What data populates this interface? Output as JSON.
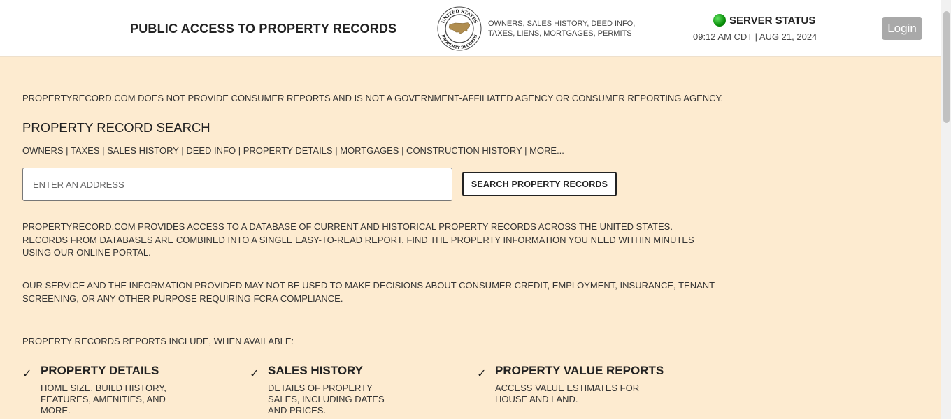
{
  "header": {
    "title": "PUBLIC ACCESS TO PROPERTY RECORDS",
    "seal_text_top": "UNITED STATES",
    "seal_text_bottom": "PROPERTY RECORDS",
    "tagline_line1": "OWNERS, SALES HISTORY, DEED INFO,",
    "tagline_line2": "TAXES, LIENS, MORTGAGES, PERMITS",
    "server_status_label": "SERVER STATUS",
    "server_status_color": "#1aa31a",
    "datetime": "09:12 AM CDT | AUG 21, 2024",
    "login_label": "Login"
  },
  "main": {
    "disclaimer": "PROPERTYRECORD.COM DOES NOT PROVIDE CONSUMER REPORTS AND IS NOT A GOVERNMENT-AFFILIATED AGENCY OR CONSUMER REPORTING AGENCY.",
    "search_heading": "PROPERTY RECORD SEARCH",
    "search_links": "OWNERS | TAXES | SALES HISTORY | DEED INFO | PROPERTY DETAILS | MORTGAGES | CONSTRUCTION HISTORY | MORE...",
    "address_placeholder": "ENTER AN ADDRESS",
    "address_value": "",
    "search_button_label": "SEARCH PROPERTY RECORDS",
    "paragraph1": "PROPERTYRECORD.COM PROVIDES ACCESS TO A DATABASE OF CURRENT AND HISTORICAL PROPERTY RECORDS ACROSS THE UNITED STATES. RECORDS FROM DATABASES ARE COMBINED INTO A SINGLE EASY-TO-READ REPORT. FIND THE PROPERTY INFORMATION YOU NEED WITHIN MINUTES USING OUR ONLINE PORTAL.",
    "paragraph2": "OUR SERVICE AND THE INFORMATION PROVIDED MAY NOT BE USED TO MAKE DECISIONS ABOUT CONSUMER CREDIT, EMPLOYMENT, INSURANCE, TENANT SCREENING, OR ANY OTHER PURPOSE REQUIRING FCRA COMPLIANCE.",
    "includes_heading": "PROPERTY RECORDS REPORTS INCLUDE, WHEN AVAILABLE:",
    "features": [
      {
        "icon": "check-icon",
        "title": "PROPERTY DETAILS",
        "description": "HOME SIZE, BUILD HISTORY, FEATURES, AMENITIES, AND MORE."
      },
      {
        "icon": "check-icon",
        "title": "SALES HISTORY",
        "description": "DETAILS OF PROPERTY SALES, INCLUDING DATES AND PRICES."
      },
      {
        "icon": "check-icon",
        "title": "PROPERTY VALUE REPORTS",
        "description": "ACCESS VALUE ESTIMATES FOR HOUSE AND LAND."
      }
    ]
  },
  "colors": {
    "page_background": "#fdebd0",
    "header_background": "#ffffff",
    "login_background": "#a9a9a9",
    "seal_map": "#b08d4f"
  }
}
